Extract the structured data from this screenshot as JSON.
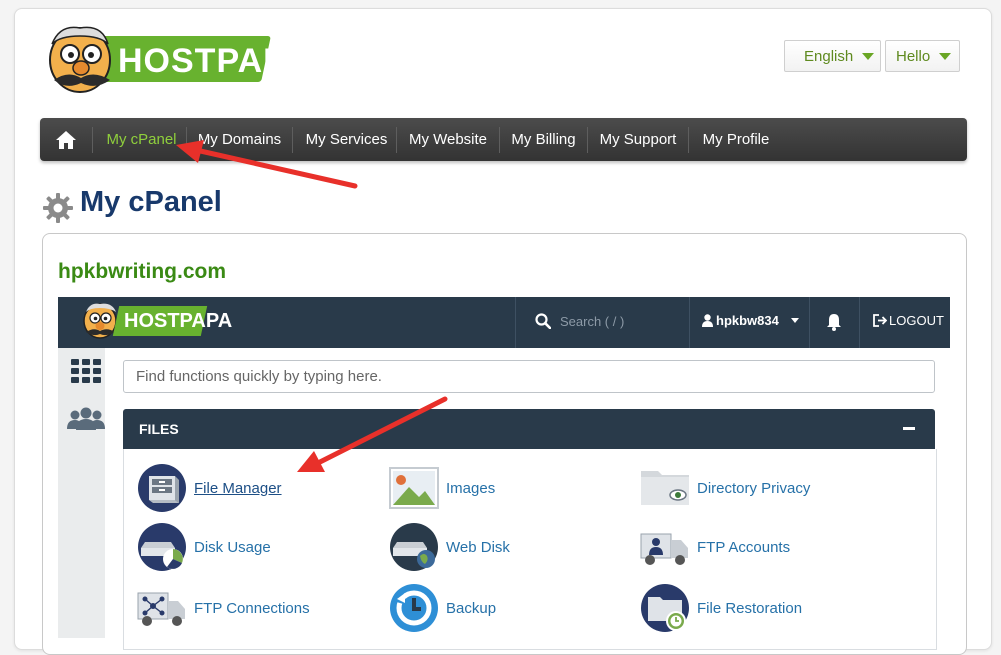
{
  "brand": {
    "name": "HOSTPAPA"
  },
  "top_buttons": {
    "language": "English",
    "greeting": "Hello"
  },
  "main_nav": {
    "items": [
      {
        "label": "My cPanel",
        "active": true
      },
      {
        "label": "My Domains"
      },
      {
        "label": "My Services"
      },
      {
        "label": "My Website"
      },
      {
        "label": "My Billing"
      },
      {
        "label": "My Support"
      },
      {
        "label": "My Profile"
      }
    ]
  },
  "page": {
    "title": "My cPanel",
    "domain": "hpkbwriting.com"
  },
  "cpanel": {
    "logo_text": "HOSTPAPA",
    "search_placeholder": "Search ( / )",
    "username": "hpkbw834",
    "logout_label": "LOGOUT",
    "quick_search_placeholder": "Find functions quickly by typing here."
  },
  "files_section": {
    "title": "FILES",
    "tools": [
      {
        "label": "File Manager",
        "icon": "file-manager-icon"
      },
      {
        "label": "Images",
        "icon": "images-icon"
      },
      {
        "label": "Directory Privacy",
        "icon": "directory-privacy-icon"
      },
      {
        "label": "Disk Usage",
        "icon": "disk-usage-icon"
      },
      {
        "label": "Web Disk",
        "icon": "web-disk-icon"
      },
      {
        "label": "FTP Accounts",
        "icon": "ftp-accounts-icon"
      },
      {
        "label": "FTP Connections",
        "icon": "ftp-connections-icon"
      },
      {
        "label": "Backup",
        "icon": "backup-icon"
      },
      {
        "label": "File Restoration",
        "icon": "file-restoration-icon"
      }
    ]
  },
  "colors": {
    "brand_green": "#68b22f",
    "nav_active": "#8fcf3c",
    "cpanel_dark": "#293a4a",
    "link_blue": "#2671a8",
    "annotation_red": "#e8302a"
  }
}
